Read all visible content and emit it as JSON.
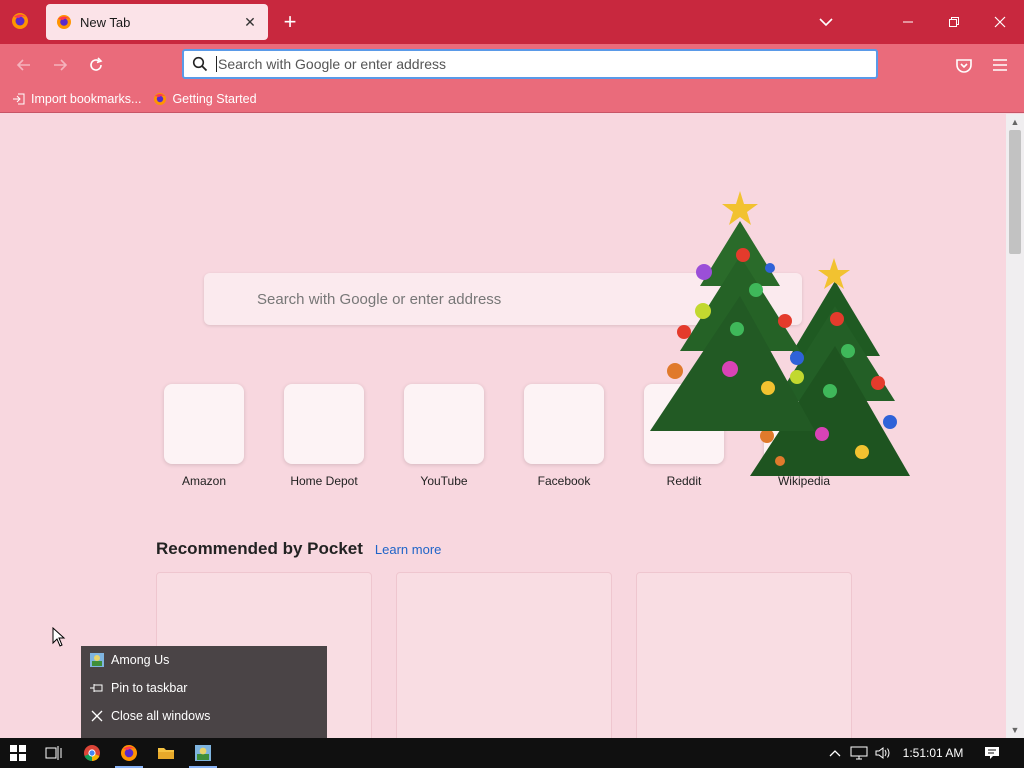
{
  "browser": {
    "tab_title": "New Tab",
    "url_placeholder": "Search with Google or enter address"
  },
  "bookmarks": [
    {
      "label": "Import bookmarks...",
      "icon": "import-icon"
    },
    {
      "label": "Getting Started",
      "icon": "firefox-icon"
    }
  ],
  "newtab": {
    "search_placeholder": "Search with Google or enter address",
    "top_sites": [
      "Amazon",
      "Home Depot",
      "YouTube",
      "Facebook",
      "Reddit",
      "Wikipedia"
    ],
    "pocket_title": "Recommended by Pocket",
    "pocket_learn_more": "Learn more"
  },
  "jumplist": {
    "items": [
      {
        "label": "Among Us",
        "icon": "among-us-icon"
      },
      {
        "label": "Pin to taskbar",
        "icon": "pin-icon"
      },
      {
        "label": "Close all windows",
        "icon": "close-icon"
      }
    ]
  },
  "taskbar": {
    "clock": "1:51:01 AM",
    "apps": [
      "start-icon",
      "task-view-icon",
      "chrome-icon",
      "firefox-icon",
      "file-explorer-icon",
      "among-us-icon"
    ]
  },
  "colors": {
    "titlebar": "#c8283e",
    "navbar": "#ea6b7b",
    "page_bg": "#f8d7df",
    "accent": "#1f64c8"
  }
}
